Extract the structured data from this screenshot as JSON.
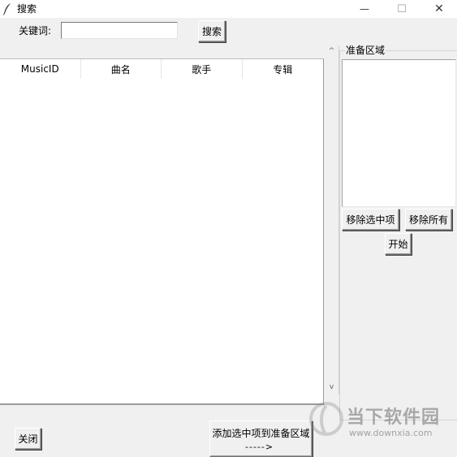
{
  "window": {
    "title": "搜索",
    "minimize_glyph": "—",
    "maximize_glyph": "☐",
    "close_glyph": "✕"
  },
  "search": {
    "keyword_label": "关键词:",
    "keyword_value": "",
    "search_button": "搜索"
  },
  "results": {
    "columns": [
      "MusicID",
      "曲名",
      "歌手",
      "专辑"
    ],
    "rows": []
  },
  "scrollbar": {
    "up_glyph": "^",
    "down_glyph": "v"
  },
  "prepare": {
    "frame_label": "准备区域",
    "items": [],
    "remove_selected": "移除选中项",
    "remove_all": "移除所有",
    "start": "开始"
  },
  "footer": {
    "close_button": "关闭",
    "add_button": "添加选中项到准备区域",
    "add_arrow": "----->"
  },
  "watermark": {
    "brand": "当下软件园",
    "url": "www.downxia.com"
  }
}
